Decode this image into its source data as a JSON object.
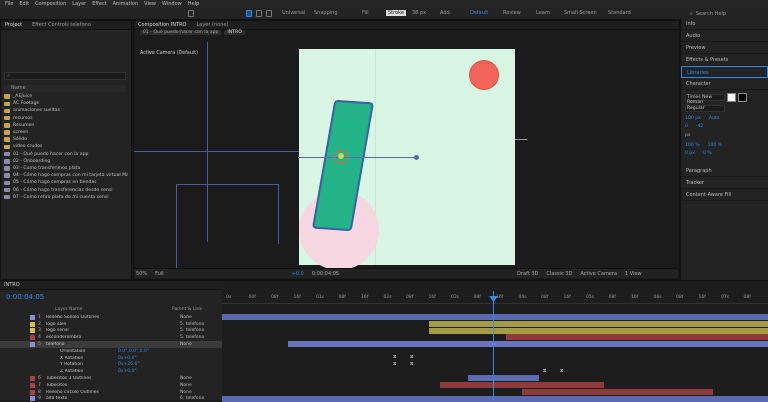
{
  "menu": [
    "File",
    "Edit",
    "Composition",
    "Layer",
    "Effect",
    "Animation",
    "View",
    "Window",
    "Help"
  ],
  "toolbar": {
    "universal": "Universal",
    "snapping": "Snapping",
    "fill": "Fill",
    "stroke": "Stroke",
    "stroke_px": "38 px",
    "add": "Add",
    "workspaces": [
      "Default",
      "Review",
      "Learn",
      "Small Screen",
      "Standard"
    ],
    "search_placeholder": "Search Help"
  },
  "project_panel": {
    "tabs": [
      "Project",
      "Effect Controls telefono"
    ],
    "search": "",
    "col_name": "Name",
    "items": [
      {
        "name": "_AEJuice",
        "type": "folder"
      },
      {
        "name": "AC Footage",
        "type": "folder"
      },
      {
        "name": "animaciones sueltas",
        "type": "folder"
      },
      {
        "name": "recursos",
        "type": "folder"
      },
      {
        "name": "Resumen",
        "type": "folder"
      },
      {
        "name": "screen",
        "type": "folder"
      },
      {
        "name": "Sólido",
        "type": "folder"
      },
      {
        "name": "video crudos",
        "type": "folder"
      },
      {
        "name": "01 - Qué puedo hacer con la app",
        "type": "comp"
      },
      {
        "name": "02 - Onboarding",
        "type": "comp"
      },
      {
        "name": "03 - Como transferimos plata",
        "type": "comp"
      },
      {
        "name": "04 - Cómo hago compras con mi tarjeta virtual Master",
        "type": "comp"
      },
      {
        "name": "05 - Cómo hago compras en tiendas",
        "type": "comp"
      },
      {
        "name": "06 - Cómo hago transferencias desde sensi",
        "type": "comp"
      },
      {
        "name": "07 - Como retiro plata de mi cuenta sensi",
        "type": "comp"
      }
    ]
  },
  "comp_panel": {
    "tab": "Composition INTRO",
    "layer_tab": "Layer (none)",
    "breadcrumb": [
      "01 - Qué puedo hacer con la app",
      "INTRO"
    ],
    "camera": "Active Camera (Default)",
    "bottom": {
      "zoom": "50%",
      "res": "Full",
      "exposure": "+0.0",
      "timecode": "0:00:04:05",
      "renderer": "Draft 3D",
      "classic": "Classic 3D",
      "camera": "Active Camera",
      "views": "1 View"
    }
  },
  "right_panel": {
    "sections": [
      "Info",
      "Audio",
      "Preview",
      "Effects & Presets",
      "Libraries",
      "Character"
    ],
    "font": "Times New Roman",
    "style": "Regular",
    "size": "100 px",
    "leading": "Auto",
    "tracking_unit": "px",
    "kerning": "0",
    "tracking": "-42",
    "vscale": "100 %",
    "hscale": "100 %",
    "baseline": "0 px",
    "tsume": "0 %",
    "bottom_sections": [
      "Paragraph",
      "Tracker",
      "Content-Aware Fill"
    ]
  },
  "timeline": {
    "tab": "INTRO",
    "timecode": "0:00:04:05",
    "col_layer": "Layer Name",
    "col_parent": "Parent & Link",
    "ruler": [
      "0s",
      "00f",
      "08f",
      "16f",
      "01s",
      "08f",
      "16f",
      "02s",
      "08f",
      "16f",
      "03s",
      "08f",
      "16f",
      "04s",
      "08f",
      "16f",
      "05s",
      "08f",
      "16f",
      "06s",
      "08f",
      "16f",
      "07s",
      "08f"
    ],
    "layers": [
      {
        "n": "1",
        "name": "Relleno Sol/olo Outlines",
        "color": "#8b8bd6",
        "parent": "None",
        "sel": false
      },
      {
        "n": "2",
        "name": "logo sale",
        "color": "#d6c24a",
        "parent": "5. telefono",
        "sel": false
      },
      {
        "n": "3",
        "name": "logo sensi",
        "color": "#d6c24a",
        "parent": "5. telefono",
        "sel": false
      },
      {
        "n": "4",
        "name": "esconderombra",
        "color": "#b04040",
        "parent": "5. telefono",
        "sel": false
      },
      {
        "n": "5",
        "name": "telefono",
        "color": "#8b8bd6",
        "parent": "None",
        "sel": true
      },
      {
        "n": "",
        "name": "Orientation",
        "color": "",
        "parent": "0.0°,0.0°,0.0°",
        "sel": false
      },
      {
        "n": "",
        "name": "X Rotation",
        "color": "",
        "parent": "0x+0.0°",
        "sel": false
      },
      {
        "n": "",
        "name": "Y Rotation",
        "color": "",
        "parent": "0x+26.6°",
        "sel": false
      },
      {
        "n": "",
        "name": "Z Rotation",
        "color": "",
        "parent": "0x+0.0°",
        "sel": false
      },
      {
        "n": "6",
        "name": "Tubecitos 3 Outlines",
        "color": "#b04040",
        "parent": "None",
        "sel": false
      },
      {
        "n": "7",
        "name": "Tubecitos",
        "color": "#b04040",
        "parent": "None",
        "sel": false
      },
      {
        "n": "8",
        "name": "Relleno circulo Outlines",
        "color": "#b04040",
        "parent": "None",
        "sel": false
      },
      {
        "n": "9",
        "name": "alfa texto",
        "color": "#8b8bd6",
        "parent": "6. telefono",
        "sel": false
      }
    ],
    "bars": [
      {
        "row": 0,
        "start": 0.0,
        "end": 1.0,
        "color": "#5c6ab0"
      },
      {
        "row": 1,
        "start": 0.38,
        "end": 1.0,
        "color": "#a59b46"
      },
      {
        "row": 2,
        "start": 0.38,
        "end": 1.0,
        "color": "#a59b46"
      },
      {
        "row": 3,
        "start": 0.52,
        "end": 1.0,
        "color": "#8e3b3b"
      },
      {
        "row": 4,
        "start": 0.12,
        "end": 1.0,
        "color": "#6a74c0"
      },
      {
        "row": 9,
        "start": 0.45,
        "end": 0.58,
        "color": "#5c6ab0"
      },
      {
        "row": 10,
        "start": 0.4,
        "end": 0.7,
        "color": "#8e3b3b"
      },
      {
        "row": 11,
        "start": 0.55,
        "end": 0.9,
        "color": "#8e3b3b"
      },
      {
        "row": 12,
        "start": 0.0,
        "end": 1.0,
        "color": "#5c6ab0"
      }
    ]
  }
}
